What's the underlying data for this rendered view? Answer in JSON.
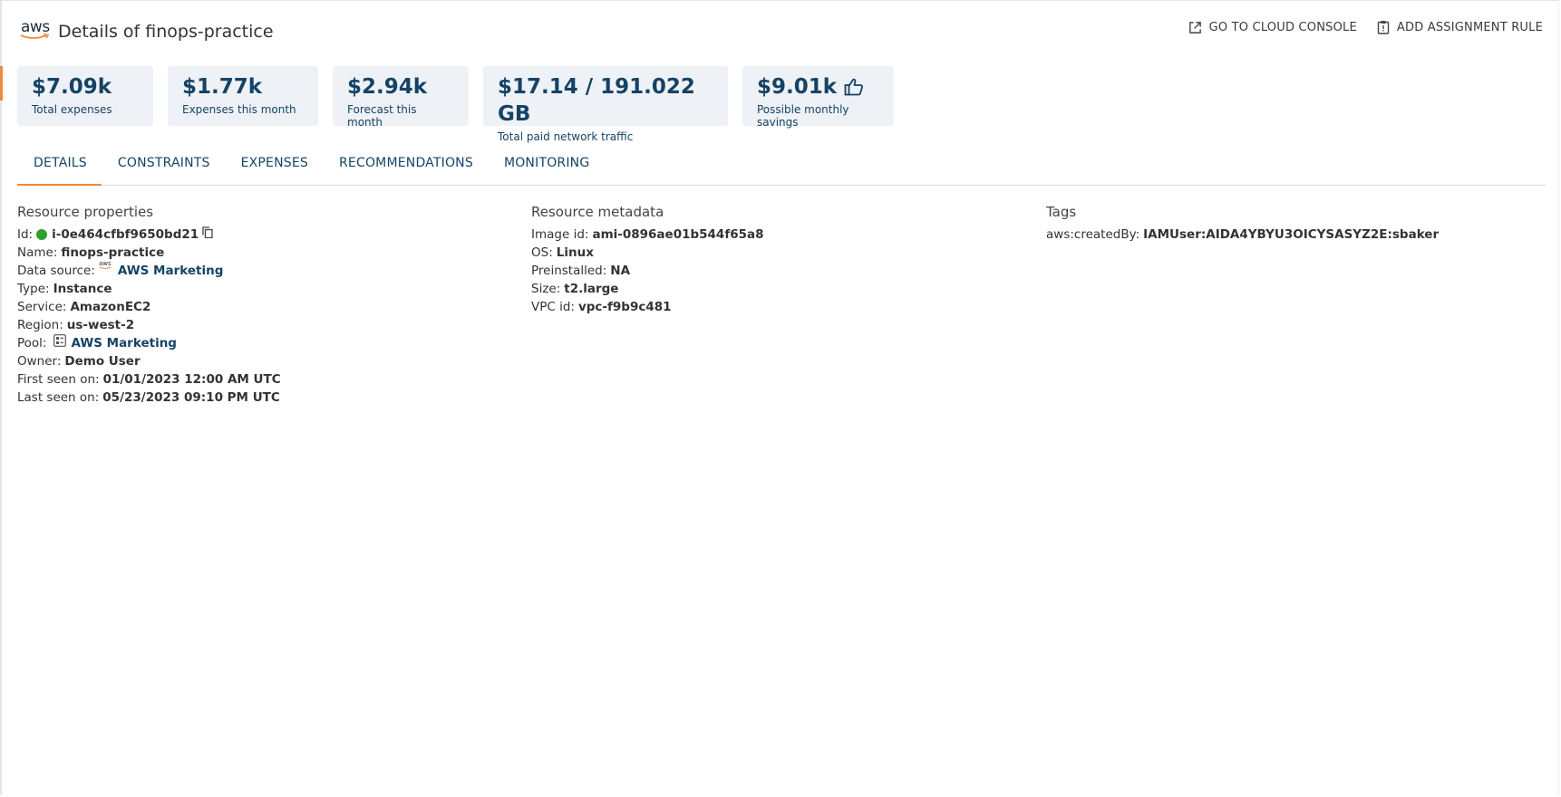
{
  "header": {
    "logo_text": "aws",
    "title": "Details of finops-practice",
    "actions": {
      "console": "GO TO CLOUD CONSOLE",
      "assignment": "ADD ASSIGNMENT RULE"
    }
  },
  "cards": [
    {
      "value": "$7.09k",
      "label": "Total expenses"
    },
    {
      "value": "$1.77k",
      "label": "Expenses this month"
    },
    {
      "value": "$2.94k",
      "label": "Forecast this month"
    },
    {
      "value": "$17.14 / 191.022 GB",
      "label": "Total paid network traffic"
    },
    {
      "value": "$9.01k",
      "label": "Possible monthly savings",
      "icon": "thumbs-up-icon"
    }
  ],
  "tabs": [
    "DETAILS",
    "CONSTRAINTS",
    "EXPENSES",
    "RECOMMENDATIONS",
    "MONITORING"
  ],
  "active_tab": "DETAILS",
  "properties": {
    "title": "Resource properties",
    "id_label": "Id:",
    "id_value": "i-0e464cfbf9650bd21",
    "name_label": "Name:",
    "name_value": "finops-practice",
    "datasource_label": "Data source:",
    "datasource_value": "AWS Marketing",
    "type_label": "Type:",
    "type_value": "Instance",
    "service_label": "Service:",
    "service_value": "AmazonEC2",
    "region_label": "Region:",
    "region_value": "us-west-2",
    "pool_label": "Pool:",
    "pool_value": "AWS Marketing",
    "owner_label": "Owner:",
    "owner_value": "Demo User",
    "first_label": "First seen on:",
    "first_value": "01/01/2023 12:00 AM UTC",
    "last_label": "Last seen on:",
    "last_value": "05/23/2023 09:10 PM UTC"
  },
  "metadata": {
    "title": "Resource metadata",
    "image_label": "Image id:",
    "image_value": "ami-0896ae01b544f65a8",
    "os_label": "OS:",
    "os_value": "Linux",
    "pre_label": "Preinstalled:",
    "pre_value": "NA",
    "size_label": "Size:",
    "size_value": "t2.large",
    "vpc_label": "VPC id:",
    "vpc_value": "vpc-f9b9c481"
  },
  "tags": {
    "title": "Tags",
    "key": "aws:createdBy:",
    "value": "IAMUser:AIDA4YBYU3OICYSASYZ2E:sbaker"
  },
  "colors": {
    "accent": "#ee8a3c",
    "primary": "#154365",
    "card_bg": "#eef2f6",
    "status_active": "#2ca02c"
  }
}
